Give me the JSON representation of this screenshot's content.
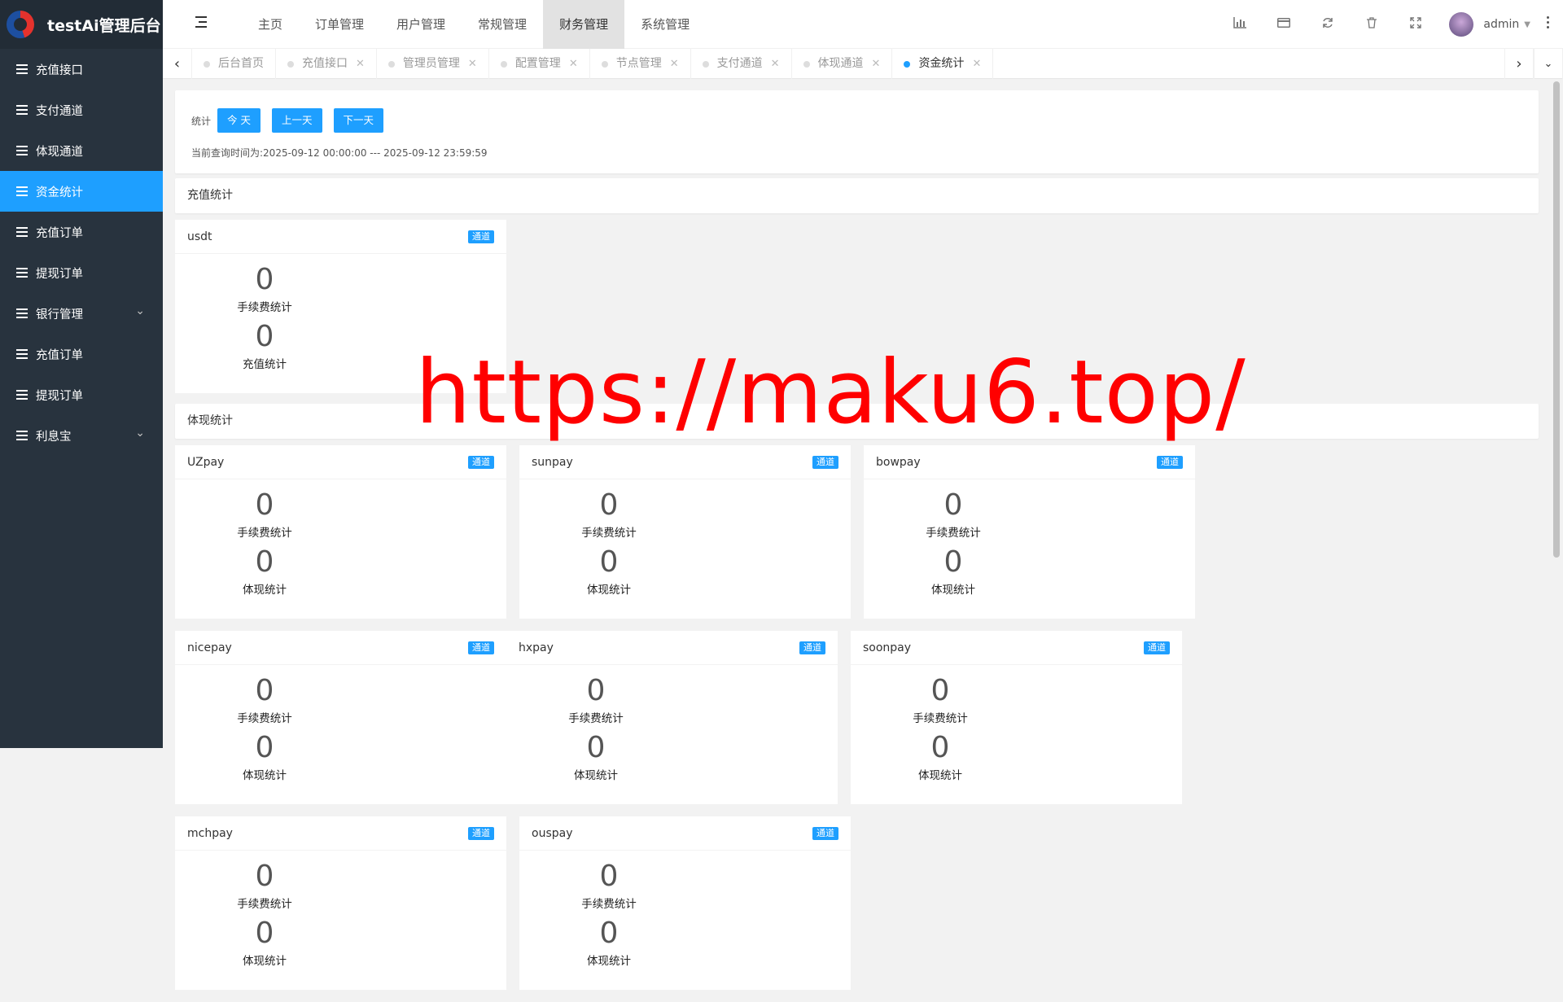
{
  "app": {
    "title": "testAi管理后台"
  },
  "sidebar": {
    "items": [
      {
        "label": "充值接口"
      },
      {
        "label": "支付通道"
      },
      {
        "label": "体现通道"
      },
      {
        "label": "资金统计"
      },
      {
        "label": "充值订单"
      },
      {
        "label": "提现订单"
      },
      {
        "label": "银行管理"
      },
      {
        "label": "充值订单"
      },
      {
        "label": "提现订单"
      },
      {
        "label": "利息宝"
      }
    ]
  },
  "topnav": {
    "items": [
      {
        "label": "主页"
      },
      {
        "label": "订单管理"
      },
      {
        "label": "用户管理"
      },
      {
        "label": "常规管理"
      },
      {
        "label": "财务管理"
      },
      {
        "label": "系统管理"
      }
    ],
    "user": "admin"
  },
  "tabs": [
    {
      "label": "后台首页"
    },
    {
      "label": "充值接口"
    },
    {
      "label": "管理员管理"
    },
    {
      "label": "配置管理"
    },
    {
      "label": "节点管理"
    },
    {
      "label": "支付通道"
    },
    {
      "label": "体现通道"
    },
    {
      "label": "资金统计"
    }
  ],
  "filter": {
    "label": "统计",
    "today": "今 天",
    "prev": "上一天",
    "next": "下一天",
    "range": "当前查询时间为:2025-09-12 00:00:00 --- 2025-09-12 23:59:59"
  },
  "recharge": {
    "title": "充值统计",
    "cards": [
      {
        "name": "usdt",
        "badge": "通道",
        "fee": "0",
        "fee_label": "手续费统计",
        "total": "0",
        "total_label": "充值统计"
      }
    ]
  },
  "withdraw": {
    "title": "体现统计",
    "cards": [
      {
        "name": "UZpay",
        "badge": "通道",
        "fee": "0",
        "fee_label": "手续费统计",
        "total": "0",
        "total_label": "体现统计"
      },
      {
        "name": "sunpay",
        "badge": "通道",
        "fee": "0",
        "fee_label": "手续费统计",
        "total": "0",
        "total_label": "体现统计"
      },
      {
        "name": "bowpay",
        "badge": "通道",
        "fee": "0",
        "fee_label": "手续费统计",
        "total": "0",
        "total_label": "体现统计"
      },
      {
        "name": "nicepay",
        "badge": "通道",
        "fee": "0",
        "fee_label": "手续费统计",
        "total": "0",
        "total_label": "体现统计"
      },
      {
        "name": "hxpay",
        "badge": "通道",
        "fee": "0",
        "fee_label": "手续费统计",
        "total": "0",
        "total_label": "体现统计"
      },
      {
        "name": "soonpay",
        "badge": "通道",
        "fee": "0",
        "fee_label": "手续费统计",
        "total": "0",
        "total_label": "体现统计"
      },
      {
        "name": "mchpay",
        "badge": "通道",
        "fee": "0",
        "fee_label": "手续费统计",
        "total": "0",
        "total_label": "体现统计"
      },
      {
        "name": "ouspay",
        "badge": "通道",
        "fee": "0",
        "fee_label": "手续费统计",
        "total": "0",
        "total_label": "体现统计"
      }
    ]
  },
  "watermark": "https://maku6.top/",
  "colors": {
    "accent": "#1e9fff",
    "sidebar": "#28333e",
    "watermark": "#ff0000"
  }
}
